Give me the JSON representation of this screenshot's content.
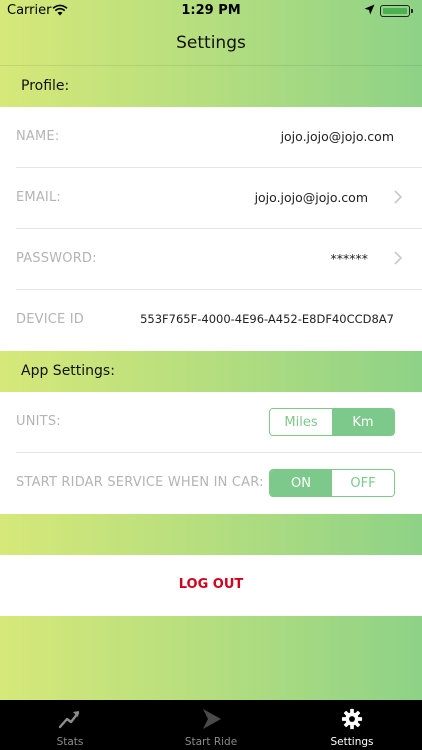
{
  "status_bar": {
    "carrier": "Carrier",
    "time": "1:29 PM"
  },
  "nav": {
    "title": "Settings"
  },
  "profile": {
    "header": "Profile:",
    "rows": [
      {
        "label": "NAME:",
        "value": "jojo.jojo@jojo.com"
      },
      {
        "label": "EMAIL:",
        "value": "jojo.jojo@jojo.com"
      },
      {
        "label": "PASSWORD:",
        "value": "******"
      },
      {
        "label": "DEVICE ID",
        "value": "553F765F-4000-4E96-A452-E8DF40CCD8A7"
      }
    ]
  },
  "app_settings": {
    "header": "App Settings:",
    "units": {
      "label": "UNITS:",
      "options": [
        "Miles",
        "Km"
      ],
      "selected": "Km"
    },
    "service": {
      "label": "START RIDAR SERVICE WHEN IN CAR:",
      "options": [
        "ON",
        "OFF"
      ],
      "selected": "ON"
    }
  },
  "logout": {
    "label": "LOG OUT"
  },
  "tabs": [
    {
      "label": "Stats",
      "icon": "trend-icon",
      "active": false
    },
    {
      "label": "Start Ride",
      "icon": "navigation-arrow-icon",
      "active": false
    },
    {
      "label": "Settings",
      "icon": "gear-icon",
      "active": true
    }
  ],
  "colors": {
    "accent": "#7dc98c",
    "logout": "#d0021b",
    "gradient_start": "#d6e879",
    "gradient_end": "#8ed287"
  }
}
